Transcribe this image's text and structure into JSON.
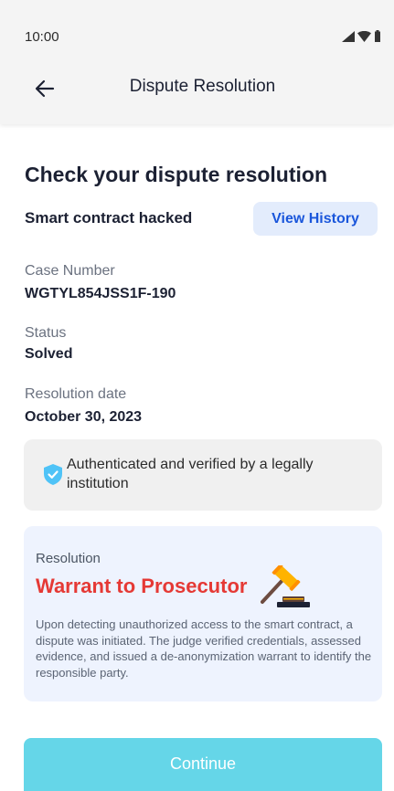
{
  "status_bar": {
    "time": "10:00",
    "icons": [
      "signal-icon",
      "wifi-icon",
      "battery-icon"
    ]
  },
  "app_bar": {
    "back_icon": "arrow-left-icon",
    "title": "Dispute Resolution"
  },
  "main": {
    "heading": "Check your dispute resolution",
    "subject": "Smart contract hacked",
    "view_history_label": "View History",
    "fields": [
      {
        "label": "Case Number",
        "value": "WGTYL854JSS1F-190"
      },
      {
        "label": "Status",
        "value": "Solved"
      },
      {
        "label": "Resolution date",
        "value": "October 30, 2023"
      }
    ],
    "verification": {
      "icon": "shield-check-icon",
      "text": "Authenticated and verified by a legally institution"
    },
    "resolution": {
      "label": "Resolution",
      "title": "Warrant to Prosecutor",
      "icon": "gavel-icon",
      "description": "Upon detecting unauthorized access to the smart contract, a dispute was initiated. The judge verified credentials, assessed evidence, and issued a de-anonymization warrant to identify the responsible party."
    },
    "continue_label": "Continue"
  },
  "colors": {
    "accent": "#1a56db",
    "danger": "#e53935",
    "continue_button": "#65d6e8",
    "shield": "#4fc3f7"
  }
}
